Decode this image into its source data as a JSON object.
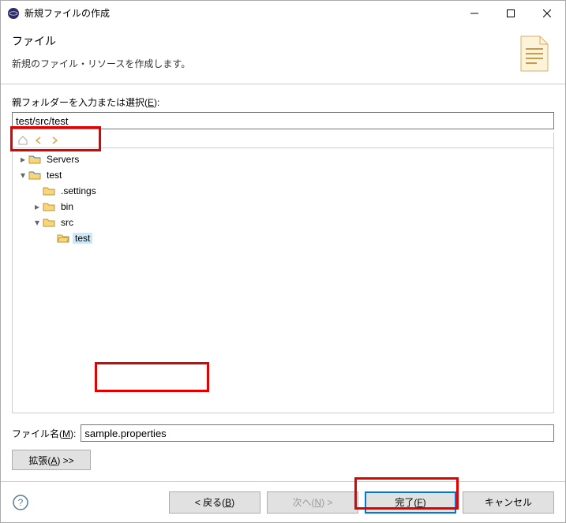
{
  "title": "新規ファイルの作成",
  "banner": {
    "title": "ファイル",
    "desc": "新規のファイル・リソースを作成します。"
  },
  "parent": {
    "label_pre": "親フォルダーを入力または選択(",
    "label_key": "E",
    "label_post": "):",
    "value": "test/src/test"
  },
  "tree": {
    "servers": "Servers",
    "test": "test",
    "settings": ".settings",
    "bin": "bin",
    "src": "src",
    "test_leaf": "test"
  },
  "filename": {
    "label_pre": "ファイル名(",
    "label_key": "M",
    "label_post": "):",
    "value": "sample.properties"
  },
  "advanced": {
    "label_pre": "拡張(",
    "label_key": "A",
    "label_post": ") >>"
  },
  "buttons": {
    "back_pre": "< 戻る(",
    "back_key": "B",
    "back_post": ")",
    "next_pre": "次へ(",
    "next_key": "N",
    "next_post": ") >",
    "finish_pre": "完了(",
    "finish_key": "F",
    "finish_post": ")",
    "cancel": "キャンセル"
  }
}
